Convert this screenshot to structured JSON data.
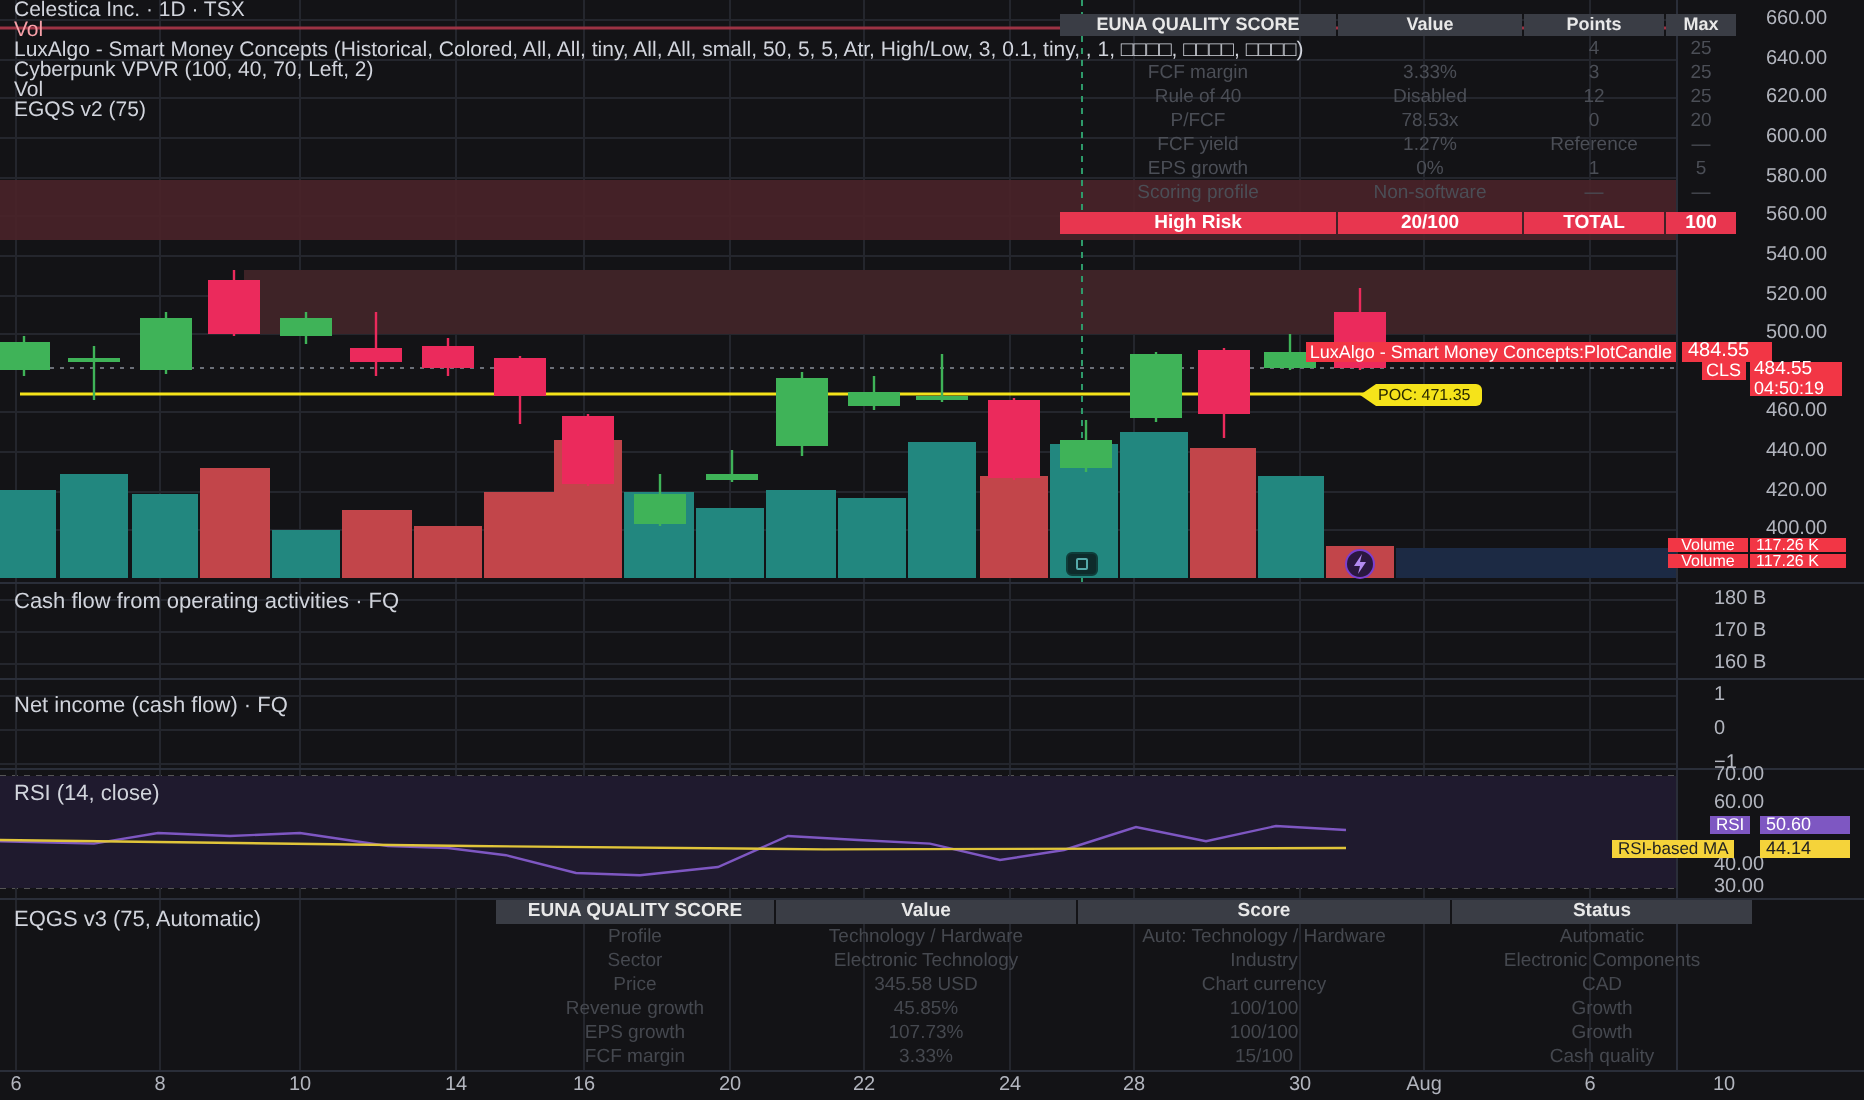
{
  "main_pane": {
    "legend": [
      {
        "text": "Celestica Inc. · 1D · TSX",
        "color": "#d1d4dc"
      },
      {
        "text": "Vol",
        "color": "#f7a0a8"
      },
      {
        "text": "LuxAlgo - Smart Money Concepts (Historical, Colored, All, All, tiny, All, All, small, 50, 5, 5, Atr, High/Low, 3, 0.1, tiny, , 1, □□□□, □□□□, □□□□)",
        "color": "#d1d4dc"
      },
      {
        "text": "Cyberpunk VPVR (100, 40, 70, Left, 2)",
        "color": "#d1d4dc"
      },
      {
        "text": "Vol",
        "color": "#d1d4dc"
      },
      {
        "text": "EGQS v2 (75)",
        "color": "#d1d4dc"
      }
    ],
    "price_axis": [
      "660.00",
      "640.00",
      "620.00",
      "600.00",
      "580.00",
      "560.00",
      "540.00",
      "520.00",
      "500.00",
      "460.00",
      "440.00",
      "420.00",
      "400.00"
    ],
    "plot_label": {
      "text": "LuxAlgo - Smart Money Concepts:PlotCandle",
      "price": "484.55"
    },
    "last_price": {
      "symbol": "CLS",
      "price": "484.55",
      "countdown": "04:50:19"
    },
    "poc_label": "POC: 471.35",
    "volume_tags": [
      {
        "label": "Volume",
        "value": "117.26 K"
      },
      {
        "label": "Volume",
        "value": "117.26 K"
      }
    ],
    "score_table": {
      "columns": [
        "EUNA QUALITY SCORE",
        "Value",
        "Points",
        "Max"
      ],
      "rows": [
        [
          "",
          "",
          "4",
          "25"
        ],
        [
          "FCF margin",
          "3.33%",
          "3",
          "25"
        ],
        [
          "Rule of 40",
          "Disabled",
          "12",
          "25"
        ],
        [
          "P/FCF",
          "78.53x",
          "0",
          "20"
        ],
        [
          "FCF yield",
          "1.27%",
          "Reference",
          "—"
        ],
        [
          "EPS growth",
          "0%",
          "1",
          "5"
        ],
        [
          "Scoring profile",
          "Non-software",
          "—",
          "—"
        ]
      ],
      "footer": [
        "High Risk",
        "20/100",
        "TOTAL",
        "100"
      ]
    }
  },
  "cash_flow_pane": {
    "title": "Cash flow from operating activities · FQ",
    "axis": [
      "180 B",
      "170 B",
      "160 B"
    ]
  },
  "net_income_pane": {
    "title": "Net income (cash flow) · FQ",
    "axis": [
      "1",
      "0",
      "−1"
    ]
  },
  "rsi_pane": {
    "title": "RSI (14, close)",
    "axis": [
      "70.00",
      "60.00",
      "40.00",
      "30.00"
    ],
    "rsi_tag": {
      "label": "RSI",
      "value": "50.60"
    },
    "ma_tag": {
      "label": "RSI-based MA",
      "value": "44.14"
    }
  },
  "eqgs_pane": {
    "title": "EQGS v3 (75, Automatic)",
    "table": {
      "columns": [
        "EUNA QUALITY SCORE",
        "Value",
        "Score",
        "Status"
      ],
      "rows": [
        [
          "Profile",
          "Technology / Hardware",
          "Auto: Technology / Hardware",
          "Automatic"
        ],
        [
          "Sector",
          "Electronic Technology",
          "Industry",
          "Electronic Components"
        ],
        [
          "Price",
          "345.58 USD",
          "Chart currency",
          "CAD"
        ],
        [
          "Revenue growth",
          "45.85%",
          "100/100",
          "Growth"
        ],
        [
          "EPS growth",
          "107.73%",
          "100/100",
          "Growth"
        ],
        [
          "FCF margin",
          "3.33%",
          "15/100",
          "Cash quality"
        ]
      ]
    }
  },
  "time_axis": [
    "6",
    "8",
    "10",
    "14",
    "16",
    "20",
    "22",
    "24",
    "28",
    "30",
    "Aug",
    "6",
    "10"
  ]
}
